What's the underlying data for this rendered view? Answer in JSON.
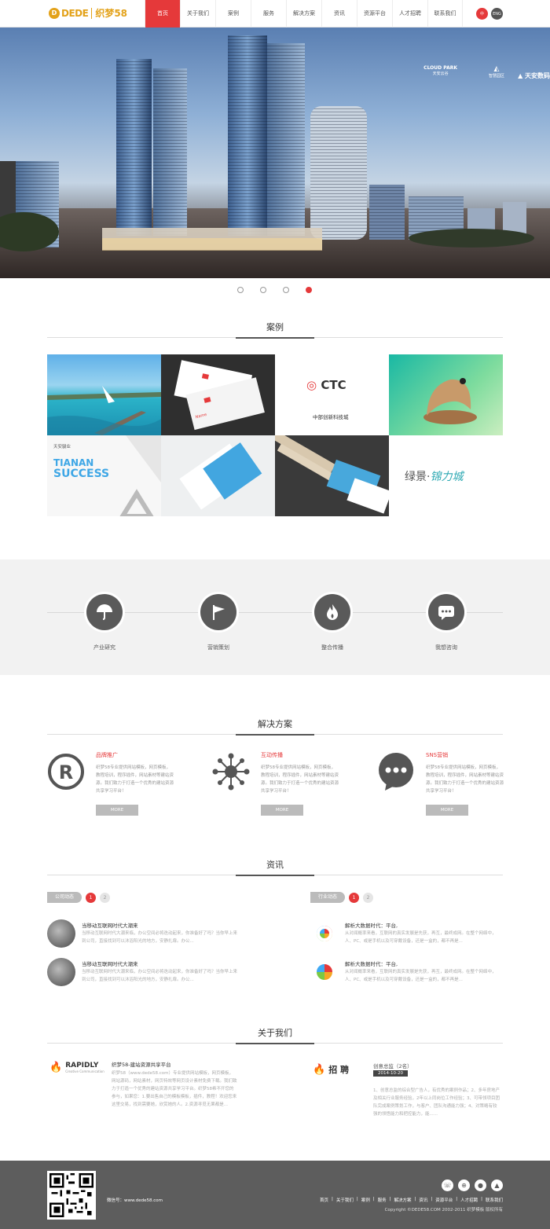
{
  "header": {
    "logo_mark": "D",
    "logo_text": "DEDE",
    "logo_cn": "织梦58",
    "nav": [
      "首页",
      "关于我们",
      "案例",
      "服务",
      "解决方案",
      "资讯",
      "资源平台",
      "人才招聘",
      "联系我们"
    ],
    "nav_active": 0,
    "lang_zh": "中",
    "lang_en": "ENG"
  },
  "banner": {
    "slide_count": 4,
    "active_slide": 4,
    "brand_cloud": "CLOUD PARK",
    "brand_cloud_cn": "天安云谷",
    "brand_park": "智慧园区",
    "brand_tianan": "天安数码"
  },
  "cases": {
    "title": "案例",
    "ctc_text": "CTC",
    "ctc_cn": "中部创新科技城",
    "tianan_cn": "天安骏业",
    "tianan_line1": "TIANAN",
    "tianan_line2": "SUCCESS",
    "lvjing": "绿景·",
    "lvjing_b": "锦力城",
    "card_name": "Name"
  },
  "services": [
    {
      "label": "产业研究",
      "icon": "umbrella-icon"
    },
    {
      "label": "营销策划",
      "icon": "flag-icon"
    },
    {
      "label": "整合传播",
      "icon": "flame-icon"
    },
    {
      "label": "我想咨询",
      "icon": "chat-icon"
    }
  ],
  "solutions": {
    "title": "解决方案",
    "items": [
      {
        "title": "品牌推广",
        "desc": "织梦58专业提供网站模板，网页模板，教程培训，程序插件，网站素材等建站资源。我们致力于打造一个优秀的建站资源共享学习平台！",
        "more": "MORE"
      },
      {
        "title": "互动传播",
        "desc": "织梦58专业提供网站模板，网页模板，教程培训，程序插件，网站素材等建站资源。我们致力于打造一个优秀的建站资源共享学习平台！",
        "more": "MORE"
      },
      {
        "title": "SNS营销",
        "desc": "织梦58专业提供网站模板，网页模板，教程培训，程序插件，网站素材等建站资源。我们致力于打造一个优秀的建站资源共享学习平台！",
        "more": "MORE"
      }
    ]
  },
  "news": {
    "title": "资讯",
    "left_tag": "公司动态",
    "right_tag": "行业动态",
    "pages": [
      "1",
      "2"
    ],
    "left": [
      {
        "title": "当移动互联网时代大潮来",
        "desc": "当移动互联网时代大潮来临，办公空间必将迭动起来，你准备好了吗？当你早上来到公司，直接找到可以沐浴阳光的地方，安静扎扉。办公..."
      },
      {
        "title": "当移动互联网时代大潮来",
        "desc": "当移动互联网时代大潮来临，办公空间必将迭动起来，你准备好了吗？当你早上来到公司，直接找到可以沐浴阳光的地方，安静扎扉。办公..."
      }
    ],
    "right": [
      {
        "title": "解析大数据时代：平台,",
        "desc": "从对闻概率来看，互联网的真实发展是先获，再互，最终成网。在整个网络中，人、PC、或是手机以及可穿戴设备，还是一盒的，都不再是..."
      },
      {
        "title": "解析大数据时代：平台,",
        "desc": "从对闻概率来看，互联网的真实发展是先获，再互，最终成网。在整个网络中，人、PC、或是手机以及可穿戴设备，还是一盒的，都不再是..."
      }
    ]
  },
  "about": {
    "title": "关于我们",
    "brand": "RAPIDLY",
    "brand_sub": "Creative Communication",
    "heading": "织梦58-建站资源共享平台",
    "desc": "织梦58（www.dede58.com）专业提供网站模板，网页模板，网站源码，网站素材，网页特效等网页设计素材免费下载。我们致力于打造一个优秀的建站资源共享学习平台。织梦58希不开您的参与，如果您：1.要出售自己的模板模板，插件，教程！欢迎您来这里交易，找到需要她，欣赏她的人。2.资源寻觅无果都是...",
    "recruit": "招 聘",
    "job_title": "创意总监（2名）",
    "job_date": "2014-10-20",
    "job_desc": "1、创意总监的综合型广告人，有优秀的案例作品；2、多年房地产及相关行业服务经验，2年以上同岗位工作经验；3、可带领项目团队完成案例策划工作，与客户、团队沟通能力强；4、对策略有较强的领悟能力和把控能力，能......"
  },
  "footer": {
    "wechat": "微信号：www.dede58.com",
    "social": [
      "☏",
      "⊕",
      "●",
      "▲"
    ],
    "links": [
      "首页",
      "|",
      "关于我们",
      "|",
      "案例",
      "|",
      "服务",
      "|",
      "解决方案",
      "|",
      "资讯",
      "|",
      "资源平台",
      "|",
      "人才招聘",
      "|",
      "联系我们"
    ],
    "copyright": "Copyright ©DEDE58.COM 2002-2011 织梦模板 版权所有"
  }
}
